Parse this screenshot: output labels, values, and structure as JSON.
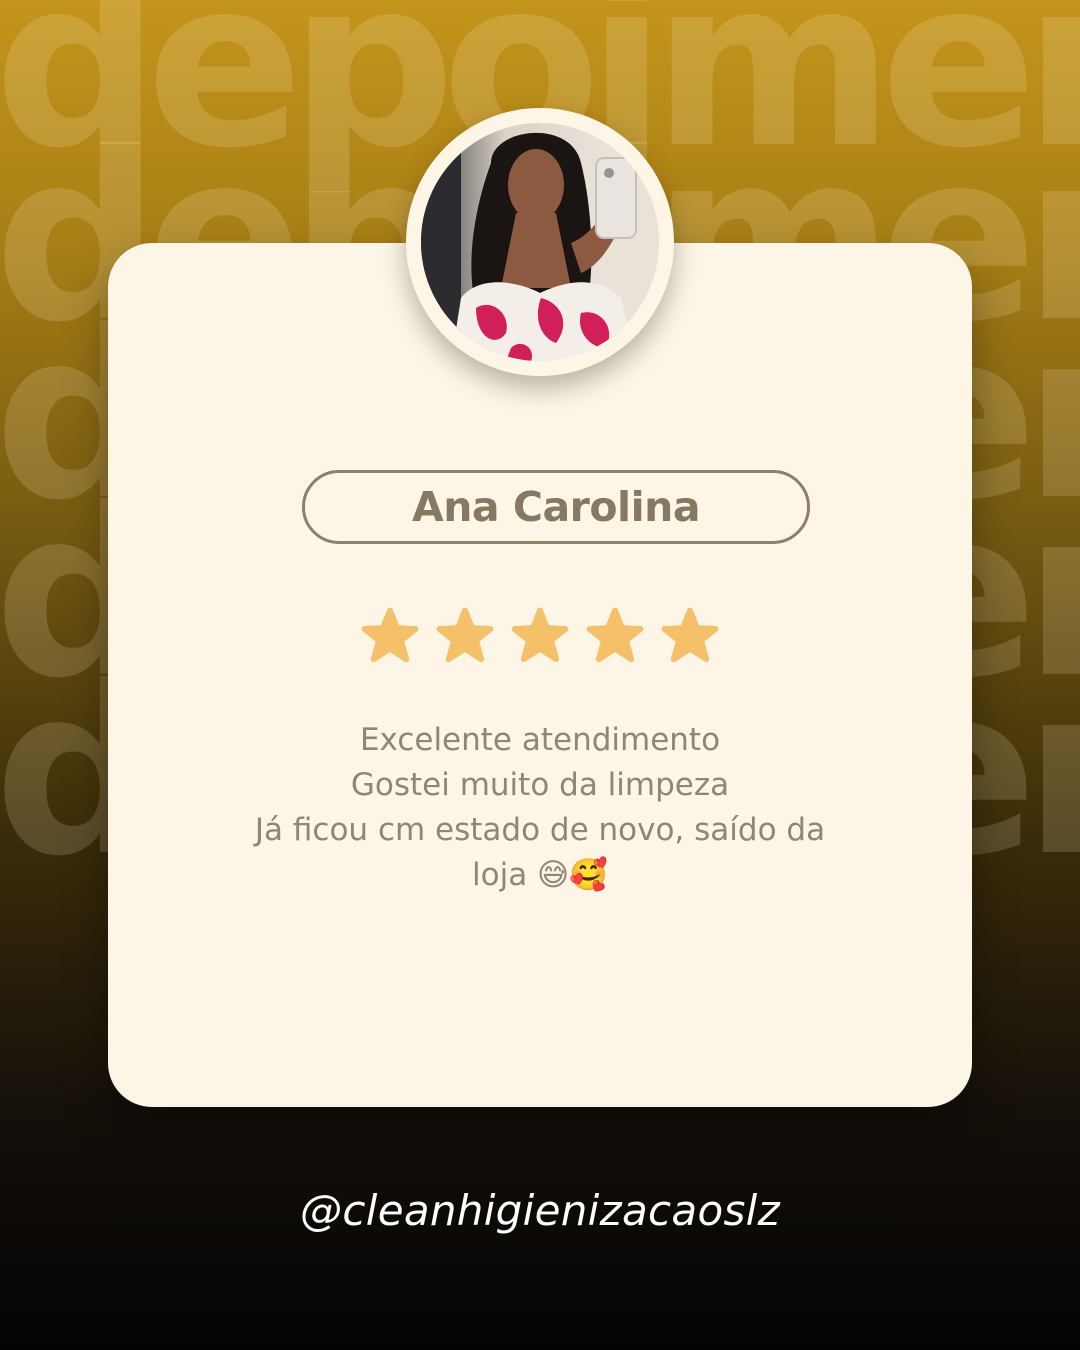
{
  "background": {
    "watermark_word": "depoimento",
    "gradient_colors": [
      "#c4951b",
      "#6e5410",
      "#030303"
    ]
  },
  "card": {
    "background_color": "#fdf6e6"
  },
  "reviewer": {
    "name": "Ana Carolina",
    "avatar_icon": "reviewer-photo"
  },
  "rating": {
    "value": 5,
    "max": 5,
    "star_color": "#f5c06a",
    "star_icon": "star-icon"
  },
  "review": {
    "lines": [
      "Excelente atendimento",
      "Gostei muito da limpeza",
      "Já ficou cm estado de novo, saído da",
      "loja  😅🥰"
    ]
  },
  "footer": {
    "handle": "@cleanhigienizacaoslz"
  }
}
